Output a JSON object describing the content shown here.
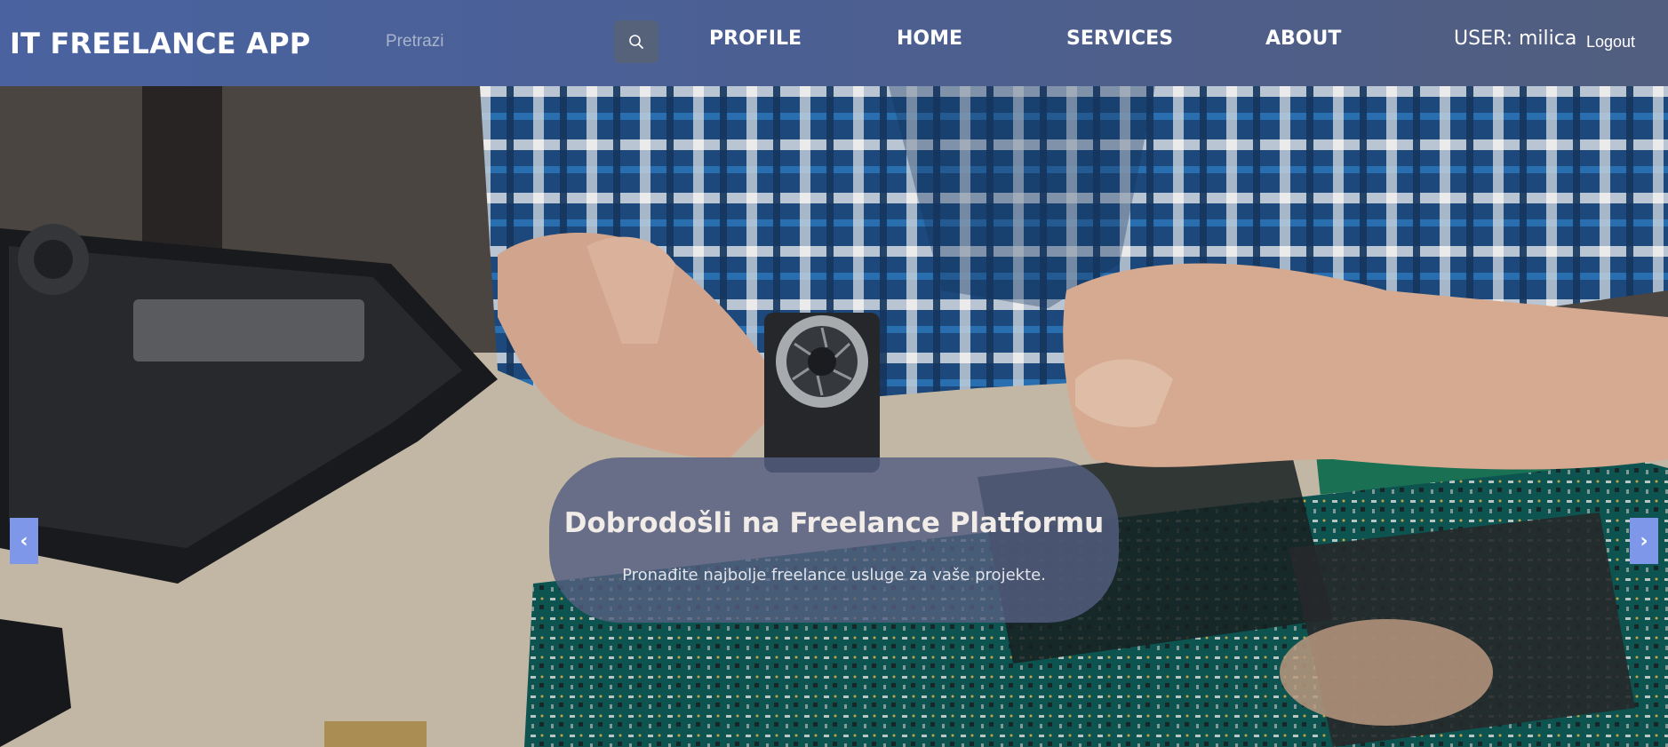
{
  "header": {
    "brand": "IT FREELANCE APP",
    "search": {
      "placeholder": "Pretrazi",
      "value": ""
    },
    "search_button_icon": "search-icon",
    "nav": {
      "profile": "PROFILE",
      "home": "HOME",
      "services": "SERVICES",
      "about": "ABOUT"
    },
    "user_label": "USER: milica",
    "logout_label": "Logout"
  },
  "hero": {
    "title": "Dobrodošli na Freelance Platformu",
    "subtitle": "Pronađite najbolje freelance usluge za vaše projekte.",
    "prev_symbol": "‹",
    "next_symbol": "›"
  },
  "colors": {
    "navbar": "#4a63a0",
    "accent": "#7f97e8",
    "caption_bg": "#545e80"
  }
}
